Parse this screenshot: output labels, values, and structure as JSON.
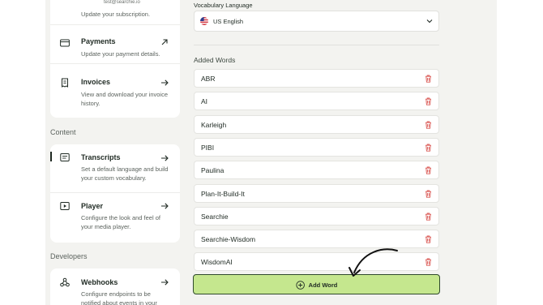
{
  "account": {
    "email": "test@searchie.io",
    "subscription_desc": "Update your subscription."
  },
  "sidebar": {
    "items": [
      {
        "title": "Payments",
        "desc": "Update your payment details.",
        "icon": "credit-card-icon",
        "arrow": "external-link-icon"
      },
      {
        "title": "Invoices",
        "desc": "View and download your invoice history.",
        "icon": "receipt-icon",
        "arrow": "arrow-right-icon"
      }
    ],
    "content_label": "Content",
    "content_items": [
      {
        "title": "Transcripts",
        "desc": "Set a default language and build your custom vocabulary.",
        "icon": "transcript-icon",
        "arrow": "arrow-right-icon"
      },
      {
        "title": "Player",
        "desc": "Configure the look and feel of your media player.",
        "icon": "player-icon",
        "arrow": "arrow-right-icon"
      }
    ],
    "developers_label": "Developers",
    "developer_items": [
      {
        "title": "Webhooks",
        "desc": "Configure endpoints to be notified about events in your",
        "icon": "webhook-icon",
        "arrow": "arrow-right-icon"
      }
    ]
  },
  "vocabulary": {
    "language_label": "Vocabulary Language",
    "language_value": "US English",
    "added_label": "Added Words",
    "words": [
      "ABR",
      "AI",
      "Karleigh",
      "PIBI",
      "Paulina",
      "Plan-It-Build-It",
      "Searchie",
      "Searchie-Wisdom",
      "WisdomAI"
    ],
    "add_label": "Add Word"
  },
  "colors": {
    "accent": "#c5e78e",
    "danger": "#d9534f",
    "text": "#1f2a23",
    "background": "#f3f3f0"
  }
}
